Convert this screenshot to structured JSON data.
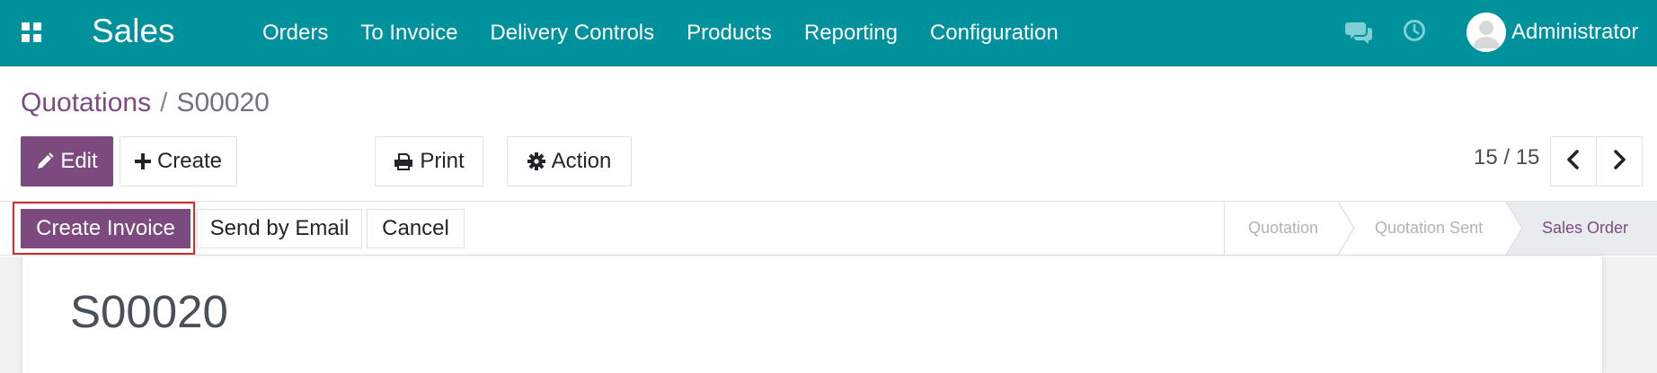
{
  "navbar": {
    "app_title": "Sales",
    "menu": [
      {
        "label": "Orders"
      },
      {
        "label": "To Invoice"
      },
      {
        "label": "Delivery Controls"
      },
      {
        "label": "Products"
      },
      {
        "label": "Reporting"
      },
      {
        "label": "Configuration"
      }
    ],
    "user_name": "Administrator",
    "icons": [
      "apps-icon",
      "chat-icon",
      "clock-icon",
      "avatar"
    ],
    "background_color": "#00929c"
  },
  "breadcrumb": {
    "parent": "Quotations",
    "separator": "/",
    "current": "S00020"
  },
  "controls": {
    "edit_label": "Edit",
    "create_label": "Create",
    "print_label": "Print",
    "action_label": "Action",
    "pager": "15 / 15"
  },
  "statusbar": {
    "buttons": [
      {
        "label": "Create Invoice"
      },
      {
        "label": "Send by Email"
      },
      {
        "label": "Cancel"
      }
    ],
    "stages": [
      {
        "label": "Quotation",
        "state": "done"
      },
      {
        "label": "Quotation Sent",
        "state": "done"
      },
      {
        "label": "Sales Order",
        "state": "current"
      }
    ]
  },
  "record": {
    "name": "S00020"
  },
  "colors": {
    "primary": "#7c4a7f",
    "highlight": "#d62a2a"
  }
}
